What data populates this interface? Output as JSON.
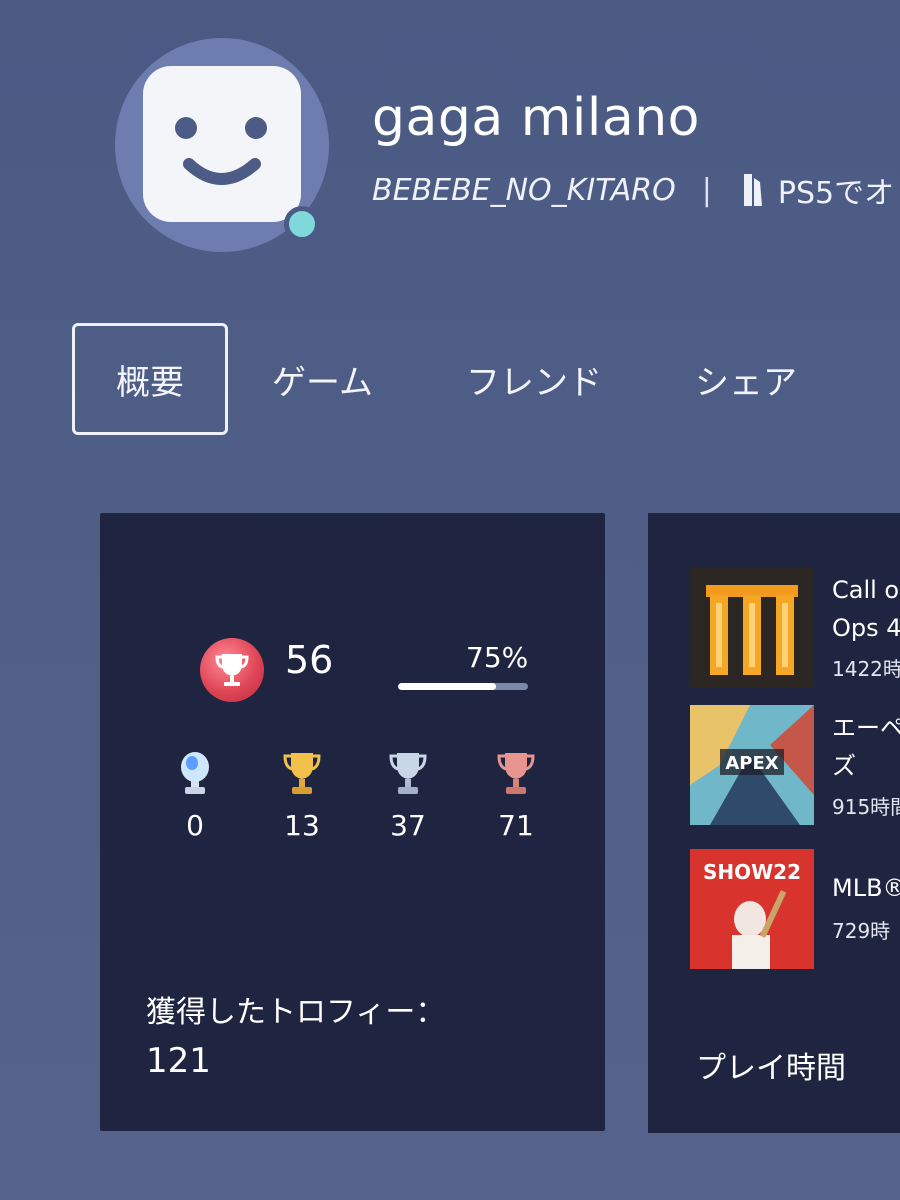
{
  "profile": {
    "display_name": "gaga milano",
    "online_id": "BEBEBE_NO_KITARO",
    "separator": "|",
    "platform_text": "PS5でオ",
    "status_color": "#7fd9dc"
  },
  "tabs": [
    {
      "label": "概要",
      "selected": true
    },
    {
      "label": "ゲーム",
      "selected": false
    },
    {
      "label": "フレンド",
      "selected": false
    },
    {
      "label": "シェア",
      "selected": false
    }
  ],
  "trophies": {
    "level": "56",
    "level_progress_label": "75%",
    "level_progress": 0.75,
    "counts": [
      {
        "type": "platinum",
        "count": "0"
      },
      {
        "type": "gold",
        "count": "13"
      },
      {
        "type": "silver",
        "count": "37"
      },
      {
        "type": "bronze",
        "count": "71"
      }
    ],
    "earned_label": "獲得したトロフィー：",
    "earned_total": "121"
  },
  "games": {
    "items": [
      {
        "title_line1": "Call o",
        "title_line2": "Ops 4",
        "hours": "1422時"
      },
      {
        "title_line1": "エーペ",
        "title_line2": "ズ",
        "hours": "915時間"
      },
      {
        "title_line1": "MLB®",
        "hours": "729時"
      }
    ],
    "thumb_texts": {
      "apex": "APEX",
      "show": "SHOW22"
    },
    "play_time_label": "プレイ時間"
  }
}
